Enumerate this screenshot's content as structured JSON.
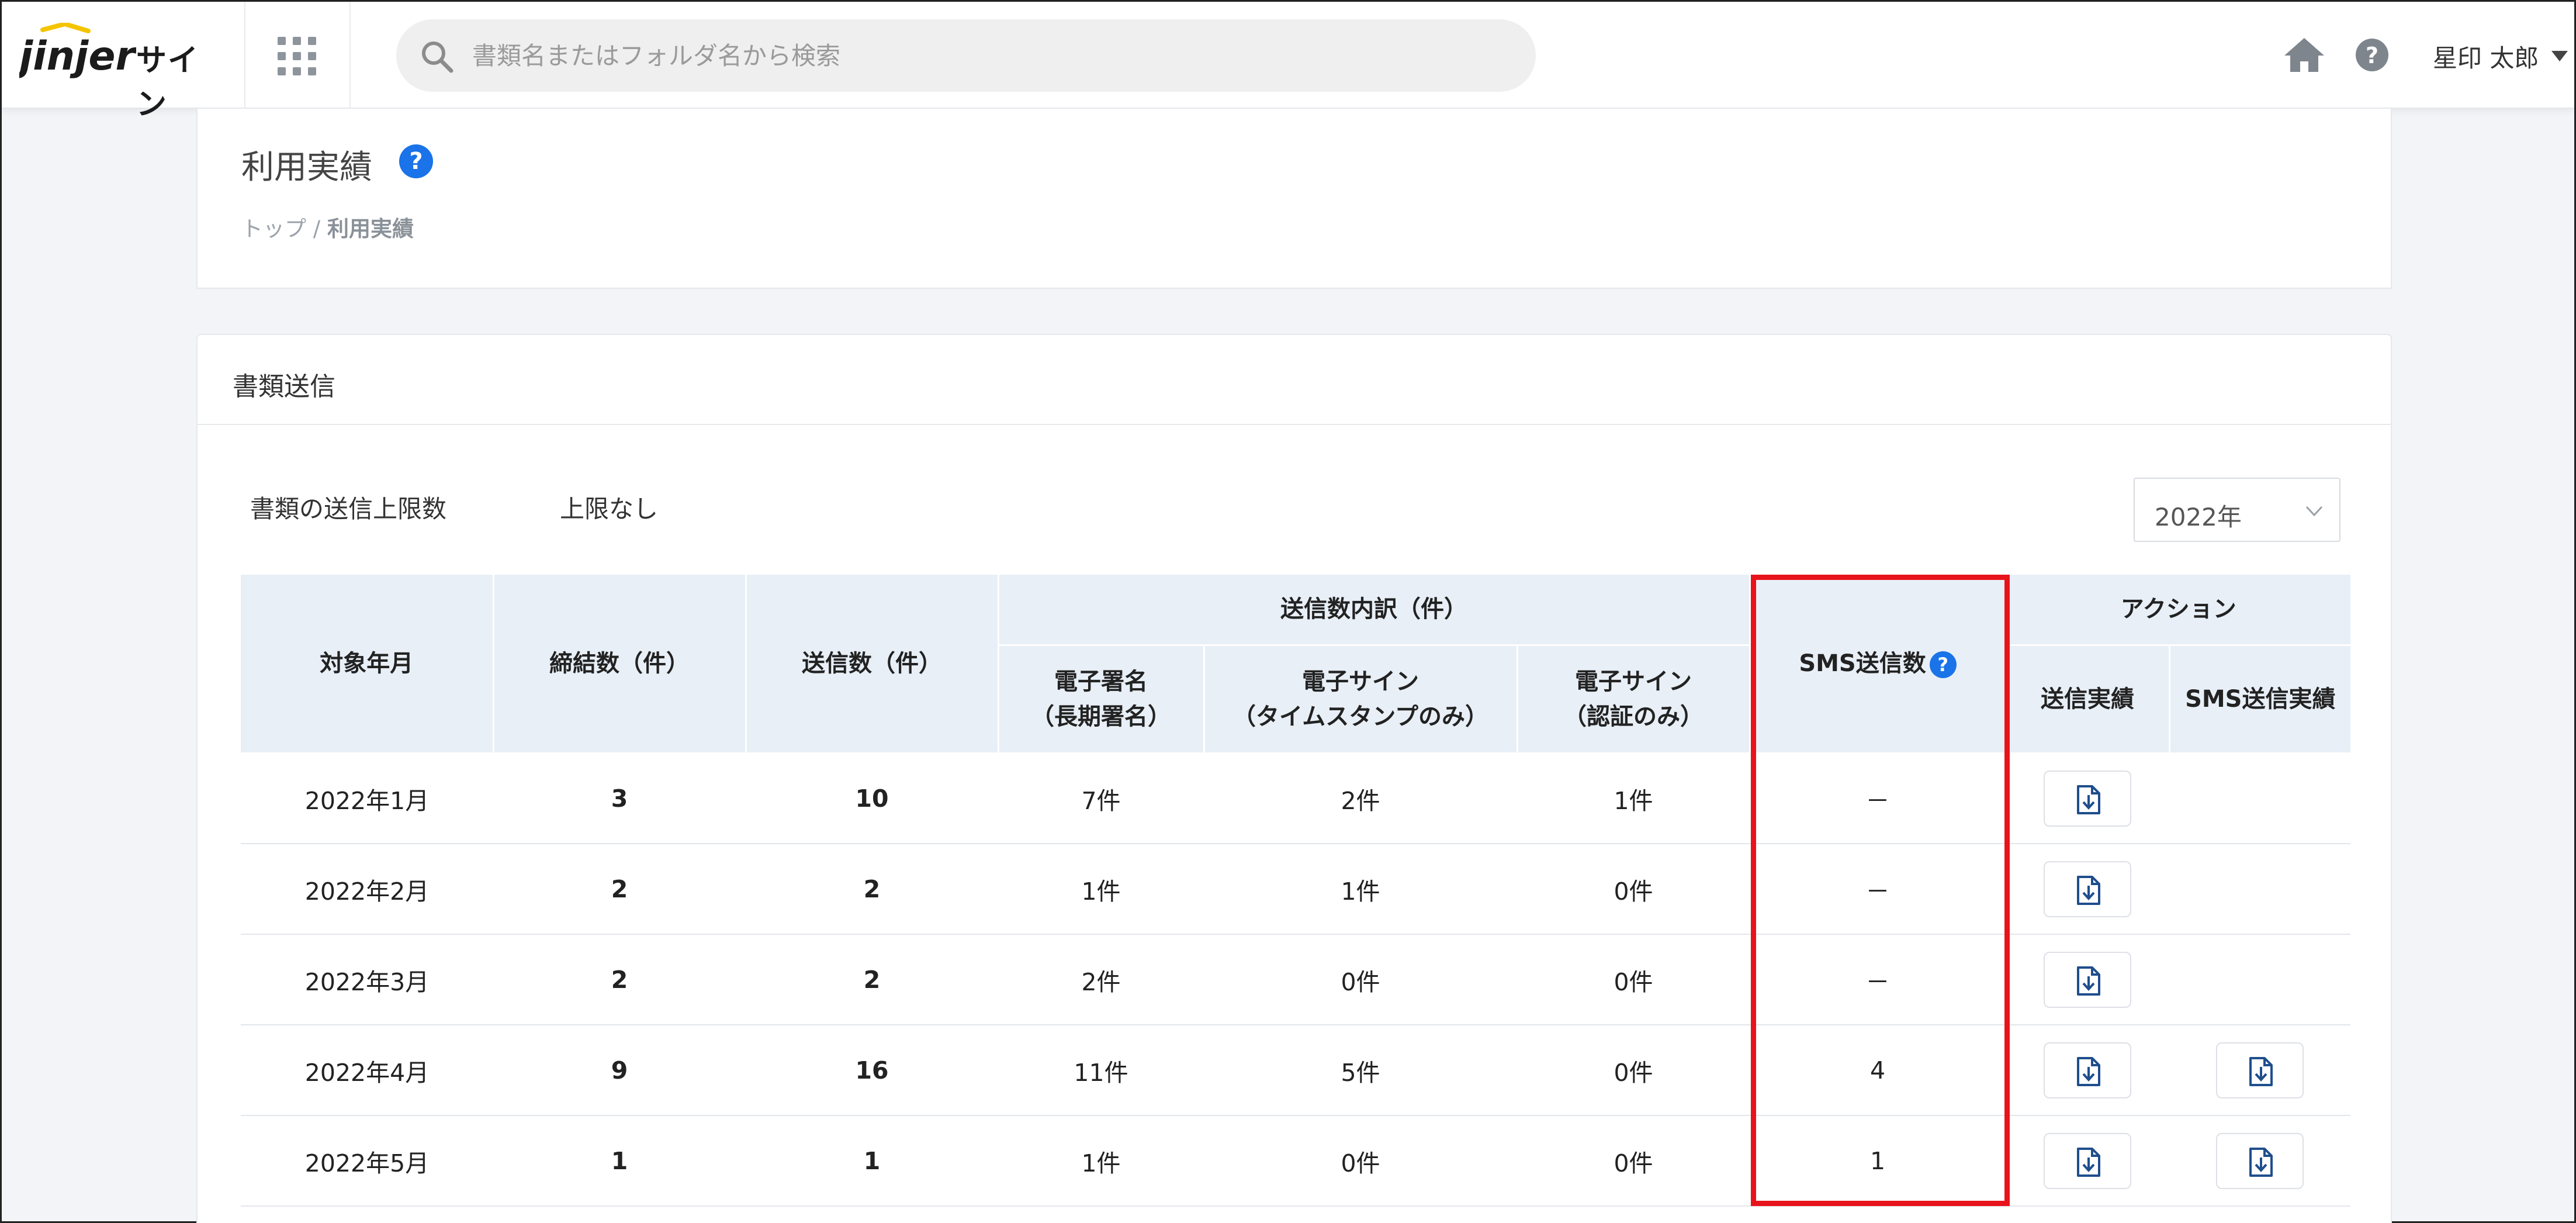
{
  "header": {
    "logo_text": "jinjer",
    "logo_sub": "サイン",
    "search_placeholder": "書類名またはフォルダ名から検索",
    "user_name": "星印 太郎"
  },
  "page": {
    "title": "利用実績",
    "help_glyph": "?",
    "breadcrumb": {
      "home": "トップ",
      "separator": " / ",
      "current": "利用実績"
    }
  },
  "section": {
    "title": "書類送信",
    "limit_label": "書類の送信上限数",
    "limit_value": "上限なし",
    "year_selected": "2022年"
  },
  "table": {
    "headers": {
      "month": "対象年月",
      "contracts": "締結数（件）",
      "sent": "送信数（件）",
      "breakdown": "送信数内訳（件）",
      "sig_long_1": "電子署名",
      "sig_long_2": "（長期署名）",
      "sig_ts_1": "電子サイン",
      "sig_ts_2": "（タイムスタンプのみ）",
      "sig_auth_1": "電子サイン",
      "sig_auth_2": "（認証のみ）",
      "sms": "SMS送信数",
      "sms_help": "?",
      "action": "アクション",
      "send_record": "送信実績",
      "sms_record": "SMS送信実績"
    },
    "rows": [
      {
        "month": "2022年1月",
        "contracts": "3",
        "sent": "10",
        "long": "7件",
        "ts": "2件",
        "auth": "1件",
        "sms": "－",
        "sms_dl": false
      },
      {
        "month": "2022年2月",
        "contracts": "2",
        "sent": "2",
        "long": "1件",
        "ts": "1件",
        "auth": "0件",
        "sms": "－",
        "sms_dl": false
      },
      {
        "month": "2022年3月",
        "contracts": "2",
        "sent": "2",
        "long": "2件",
        "ts": "0件",
        "auth": "0件",
        "sms": "－",
        "sms_dl": false
      },
      {
        "month": "2022年4月",
        "contracts": "9",
        "sent": "16",
        "long": "11件",
        "ts": "5件",
        "auth": "0件",
        "sms": "4",
        "sms_dl": true
      },
      {
        "month": "2022年5月",
        "contracts": "1",
        "sent": "1",
        "long": "1件",
        "ts": "0件",
        "auth": "0件",
        "sms": "1",
        "sms_dl": true
      }
    ]
  },
  "colors": {
    "accent_blue": "#1a73e8",
    "highlight_red": "#e8141b",
    "header_bg": "#e8eff7",
    "icon_blue": "#1f4e8c"
  }
}
